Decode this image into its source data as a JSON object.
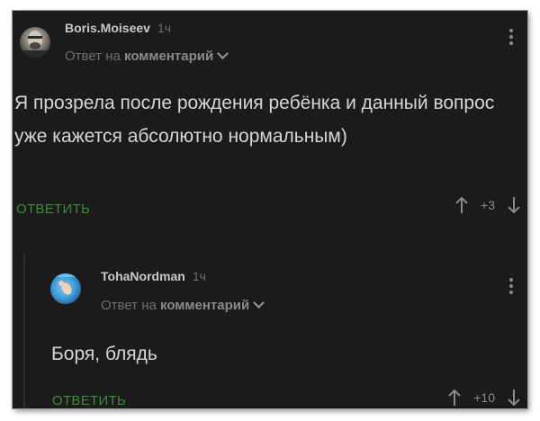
{
  "comments": [
    {
      "username": "Boris.Moiseev",
      "time": "1ч",
      "reply_prefix": "Ответ на",
      "reply_target": "комментарий",
      "text": "Я прозрела после рождения ребёнка и данный вопрос уже кажется абсолютно нормальным)",
      "reply_label": "ОТВЕТИТЬ",
      "score": "+3",
      "avatar_icon": "user-photo"
    },
    {
      "username": "TohaNordman",
      "time": "1ч",
      "reply_prefix": "Ответ на",
      "reply_target": "комментарий",
      "text": "Боря, блядь",
      "reply_label": "ОТВЕТИТЬ",
      "score": "+10",
      "avatar_icon": "underwater-baby-photo"
    }
  ],
  "colors": {
    "background": "#1b1b1b",
    "accent_green": "#3f8b3a",
    "muted_text": "#6f6f6f",
    "body_text": "#d6d6d6"
  },
  "icons": {
    "upvote": "arrow-up-icon",
    "downvote": "arrow-down-icon",
    "menu": "kebab-menu-icon",
    "expand": "chevron-down-icon"
  }
}
